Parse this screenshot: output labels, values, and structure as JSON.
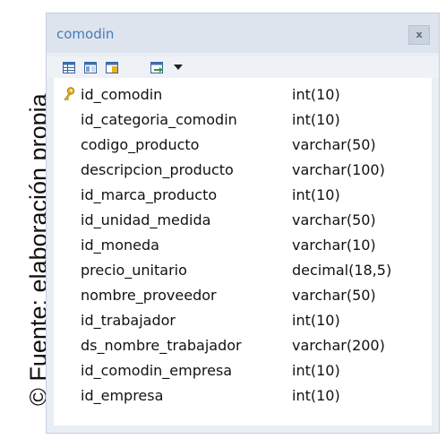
{
  "caption": "© Fuente: elaboración propia",
  "window": {
    "title": "comodin",
    "close_label": "x"
  },
  "toolbar": {
    "icons": [
      "table-grid-icon",
      "table-view-icon",
      "key-table-icon",
      "export-icon"
    ],
    "dropdown_icon": "chevron-down-icon"
  },
  "columns": [
    {
      "name": "id_comodin",
      "type": "int(10)",
      "primary_key": true
    },
    {
      "name": "id_categoria_comodin",
      "type": "int(10)"
    },
    {
      "name": "codigo_producto",
      "type": "varchar(50)"
    },
    {
      "name": "descripcion_producto",
      "type": "varchar(100)"
    },
    {
      "name": "id_marca_producto",
      "type": "int(10)"
    },
    {
      "name": "id_unidad_medida",
      "type": "varchar(50)"
    },
    {
      "name": "id_moneda",
      "type": "varchar(10)"
    },
    {
      "name": "precio_unitario",
      "type": "decimal(18,5)"
    },
    {
      "name": "nombre_proveedor",
      "type": "varchar(50)"
    },
    {
      "name": "id_trabajador",
      "type": "int(10)"
    },
    {
      "name": "ds_nombre_trabajador",
      "type": "varchar(200)"
    },
    {
      "name": "id_comodin_empresa",
      "type": "int(10)"
    },
    {
      "name": "id_empresa",
      "type": "int(10)"
    }
  ],
  "colors": {
    "title": "#4a7ab5",
    "window_bg": "#e9eef5",
    "key": "#e0b020"
  }
}
